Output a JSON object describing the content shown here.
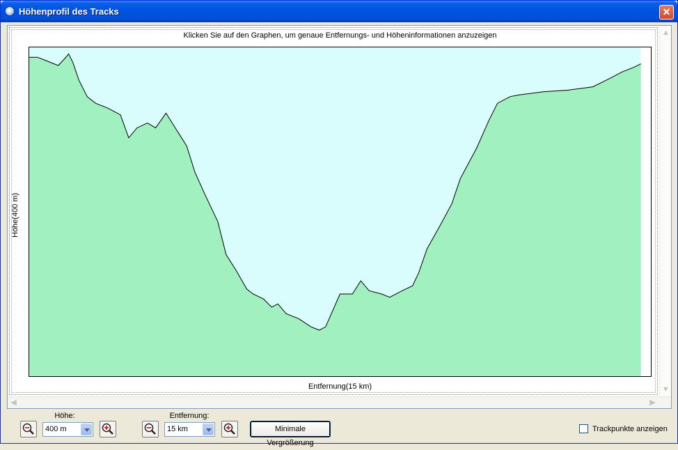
{
  "window": {
    "title": "Höhenprofil des Tracks",
    "close_label": "✕"
  },
  "graph": {
    "instructions": "Klicken Sie auf den Graphen, um genaue Entfernungs- und Höheninformationen anzuzeigen",
    "y_axis_label": "Höhe(400 m)",
    "x_axis_label": "Entfernung(15 km)",
    "sky_color": "#d9fcfc",
    "ground_color": "#a0f0c0"
  },
  "chart_data": {
    "type": "area",
    "title": "",
    "xlabel": "Entfernung(15 km)",
    "ylabel": "Höhe(400 m)",
    "xlim": [
      0,
      15
    ],
    "ylim": [
      0,
      400
    ],
    "x": [
      0.0,
      0.2,
      0.4,
      0.7,
      0.85,
      0.95,
      1.05,
      1.2,
      1.4,
      1.6,
      1.9,
      2.2,
      2.4,
      2.6,
      2.85,
      3.05,
      3.3,
      3.6,
      3.8,
      4.0,
      4.25,
      4.55,
      4.75,
      5.0,
      5.25,
      5.4,
      5.65,
      5.85,
      6.0,
      6.2,
      6.5,
      6.8,
      7.0,
      7.15,
      7.5,
      7.8,
      8.0,
      8.2,
      8.5,
      8.7,
      9.0,
      9.25,
      9.4,
      9.6,
      9.9,
      10.2,
      10.4,
      10.8,
      11.1,
      11.3,
      11.6,
      11.8,
      12.4,
      13.0,
      13.6,
      14.0,
      14.3,
      14.6,
      14.76
    ],
    "values": [
      388,
      388,
      384,
      378,
      386,
      392,
      382,
      360,
      340,
      332,
      326,
      318,
      290,
      302,
      308,
      302,
      320,
      296,
      280,
      248,
      220,
      188,
      148,
      128,
      106,
      100,
      94,
      84,
      88,
      76,
      70,
      60,
      56,
      60,
      100,
      100,
      116,
      104,
      100,
      96,
      104,
      110,
      126,
      155,
      182,
      210,
      240,
      278,
      312,
      332,
      340,
      342,
      346,
      348,
      352,
      362,
      370,
      376,
      380
    ],
    "grid": false,
    "legend": "none"
  },
  "controls": {
    "hoehe": {
      "label": "Höhe:",
      "value": "400 m"
    },
    "entfernung": {
      "label": "Entfernung:",
      "value": "15 km"
    },
    "min_zoom_button": "Minimale Vergrößerung",
    "trackpoints_checkbox": {
      "label": "Trackpunkte anzeigen",
      "checked": false
    }
  }
}
